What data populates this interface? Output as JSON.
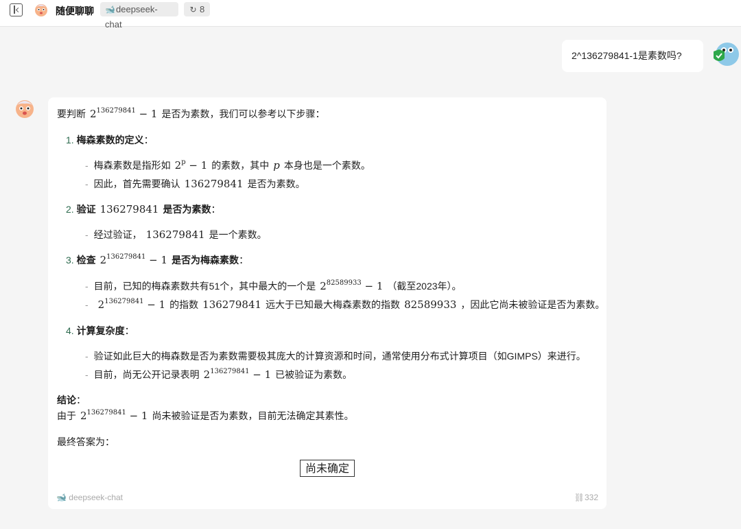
{
  "topbar": {
    "title": "随便聊聊",
    "model_chip": "deepseek-chat",
    "history_count": "8"
  },
  "user_message": {
    "text": "2^136279841-1是素数吗?"
  },
  "answer": {
    "intro_pre": "要判断",
    "intro_post": "是否为素数，我们可以参考以下步骤：",
    "s1_num": "1.",
    "s1_title": "梅森素数的定义",
    "s1_b1_pre": "梅森素数是指形如",
    "s1_b1_mid": "的素数，其中",
    "s1_b1_post": "本身也是一个素数。",
    "s1_b2_pre": "因此，首先需要确认",
    "s1_b2_post": "是否为素数。",
    "s2_num": "2.",
    "s2_title_pre": "验证",
    "s2_title_post": "是否为素数",
    "s2_b1_pre": "经过验证，",
    "s2_b1_post": "是一个素数。",
    "s3_num": "3.",
    "s3_title_pre": "检查",
    "s3_title_post": "是否为梅森素数",
    "s3_b1_pre": "目前，已知的梅森素数共有51个，其中最大的一个是",
    "s3_b1_post": "（截至2023年）。",
    "s3_b2_mid1": "的指数",
    "s3_b2_mid2": "远大于已知最大梅森素数的指数",
    "s3_b2_post": "，因此它尚未被验证是否为素数。",
    "s4_num": "4.",
    "s4_title": "计算复杂度",
    "s4_b1": "验证如此巨大的梅森数是否为素数需要极其庞大的计算资源和时间，通常使用分布式计算项目（如GIMPS）来进行。",
    "s4_b2_pre": "目前，尚无公开记录表明",
    "s4_b2_post": "已被验证为素数。",
    "conclusion_title": "结论",
    "conclusion_pre": "由于",
    "conclusion_post": "尚未被验证是否为素数，目前无法确定其素性。",
    "final_label": "最终答案为：",
    "boxed": "尚未确定",
    "colon": "：",
    "bullet": "-",
    "math_base": "2",
    "math_p": "p",
    "math_exp_big": "136279841",
    "math_exp_known": "82589933",
    "math_minus_one": "− 1",
    "math_n": "136279841",
    "math_known": "82589933",
    "math_pvar": "p"
  },
  "footer": {
    "model": "deepseek-chat",
    "tokens": "332"
  }
}
